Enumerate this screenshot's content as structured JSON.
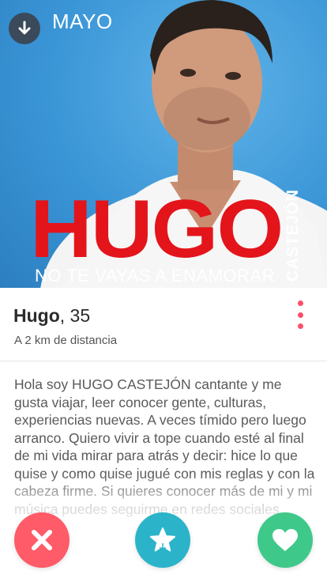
{
  "photo": {
    "label_month": "MAYO",
    "poster_title": "HUGO",
    "poster_subtitle": "NO TE VAYAS A ENAMORAR",
    "poster_vertical": "CASTEJÓN"
  },
  "profile": {
    "name": "Hugo",
    "age": ", 35",
    "distance": "A 2 km de distancia"
  },
  "bio": "Hola soy HUGO CASTEJÓN cantante y me gusta viajar, leer conocer gente, culturas, experiencias nuevas. A veces tímido pero luego arranco. Quiero vivir a tope cuando esté al final de mi vida mirar para atrás y decir: hice lo que quise y como quise jugué con mis reglas y con la cabeza firme. Si quieres conocer más de mi y mi música puedes seguirme en redes sociales",
  "colors": {
    "nope": "#ff5b68",
    "super_like": "#2bb3c9",
    "like": "#3ec98a",
    "accent": "#fd5068",
    "poster_red": "#e4141b"
  },
  "icons": {
    "download": "download-arrow-icon",
    "more": "more-vertical-icon",
    "nope": "close-icon",
    "super_like": "star-icon",
    "like": "heart-icon"
  }
}
